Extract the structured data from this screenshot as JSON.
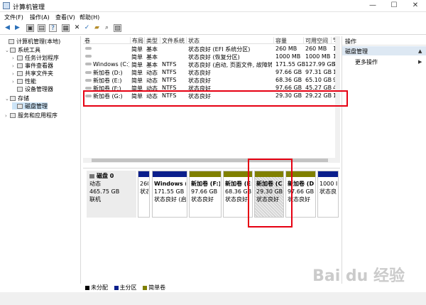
{
  "window": {
    "title": "计算机管理",
    "minimize": "—",
    "maximize": "☐",
    "close": "✕"
  },
  "menu": [
    "文件(F)",
    "操作(A)",
    "查看(V)",
    "帮助(H)"
  ],
  "toolbar": [
    {
      "name": "back-icon",
      "glyph": "◀"
    },
    {
      "name": "forward-icon",
      "glyph": "▶"
    },
    {
      "name": "up-icon",
      "glyph": "▣"
    },
    {
      "name": "show-hide-tree-icon",
      "glyph": "▤"
    },
    {
      "name": "help-icon",
      "glyph": "?"
    },
    {
      "name": "properties-icon",
      "glyph": "▦"
    },
    {
      "name": "delete-icon",
      "glyph": "✕"
    },
    {
      "name": "checkmark-icon",
      "glyph": "✓"
    },
    {
      "name": "open-folder-icon",
      "glyph": "▰"
    },
    {
      "name": "search-icon",
      "glyph": "⌕"
    },
    {
      "name": "view-icon",
      "glyph": "▧"
    }
  ],
  "tree": [
    {
      "label": "计算机管理(本地)",
      "exp": "",
      "level": 0
    },
    {
      "label": "系统工具",
      "exp": "⌄",
      "level": 1
    },
    {
      "label": "任务计划程序",
      "exp": "›",
      "level": 2
    },
    {
      "label": "事件查看器",
      "exp": "›",
      "level": 2
    },
    {
      "label": "共享文件夹",
      "exp": "›",
      "level": 2
    },
    {
      "label": "性能",
      "exp": "›",
      "level": 2
    },
    {
      "label": "设备管理器",
      "exp": "",
      "level": 2
    },
    {
      "label": "存储",
      "exp": "⌄",
      "level": 1
    },
    {
      "label": "磁盘管理",
      "exp": "",
      "level": 2,
      "selected": true
    },
    {
      "label": "服务和应用程序",
      "exp": "›",
      "level": 1
    }
  ],
  "volume_table": {
    "headers": [
      "卷",
      "布局",
      "类型",
      "文件系统",
      "状态",
      "容量",
      "可用空间",
      "%"
    ],
    "rows": [
      [
        "",
        "简单",
        "基本",
        "",
        "状态良好 (EFI 系统分区)",
        "260 MB",
        "260 MB",
        "10"
      ],
      [
        "",
        "简单",
        "基本",
        "",
        "状态良好 (恢复分区)",
        "1000 MB",
        "1000 MB",
        "10"
      ],
      [
        "Windows (C:)",
        "简单",
        "基本",
        "NTFS",
        "状态良好 (启动, 页面文件, 故障转储)",
        "171.55 GB",
        "127.99 GB",
        "75"
      ],
      [
        "新加卷 (D:)",
        "简单",
        "动态",
        "NTFS",
        "状态良好",
        "97.66 GB",
        "97.31 GB",
        "10"
      ],
      [
        "新加卷 (E:)",
        "简单",
        "动态",
        "NTFS",
        "状态良好",
        "68.36 GB",
        "65.10 GB",
        "95"
      ],
      [
        "新加卷 (F:)",
        "简单",
        "动态",
        "NTFS",
        "状态良好",
        "97.66 GB",
        "45.27 GB",
        "46"
      ],
      [
        "新加卷 (G:)",
        "简单",
        "动态",
        "NTFS",
        "状态良好",
        "29.30 GB",
        "29.22 GB",
        "10"
      ]
    ]
  },
  "disk0": {
    "name": "磁盘 0",
    "type": "动态",
    "size": "465.75 GB",
    "status": "联机",
    "partitions": [
      {
        "line1": "260",
        "line2": "状态",
        "line3": "",
        "bar": "#0b1f8c"
      },
      {
        "line1": "Windows (",
        "line2": "171.55 GB",
        "line3": "状态良好 (启",
        "bar": "#0b1f8c"
      },
      {
        "line1": "新加卷 (F:)",
        "line2": "97.66 GB",
        "line3": "状态良好",
        "bar": "#808000"
      },
      {
        "line1": "新加卷 (E:",
        "line2": "68.36 GB",
        "line3": "状态良好",
        "bar": "#808000"
      },
      {
        "line1": "新加卷 (C",
        "line2": "29.30 GB",
        "line3": "状态良好",
        "bar": "#808000",
        "hatched": true
      },
      {
        "line1": "新加卷 (D:",
        "line2": "97.66 GB",
        "line3": "状态良好",
        "bar": "#808000"
      },
      {
        "line1": "1000 I",
        "line2": "状态良",
        "line3": "",
        "bar": "#0b1f8c"
      }
    ]
  },
  "legend": [
    {
      "label": "未分配",
      "color": "#000000"
    },
    {
      "label": "主分区",
      "color": "#0b1f8c"
    },
    {
      "label": "简单卷",
      "color": "#808000"
    }
  ],
  "actions": {
    "title": "操作",
    "section": "磁盘管理",
    "more": "更多操作"
  },
  "watermark": "Bai du 经验"
}
